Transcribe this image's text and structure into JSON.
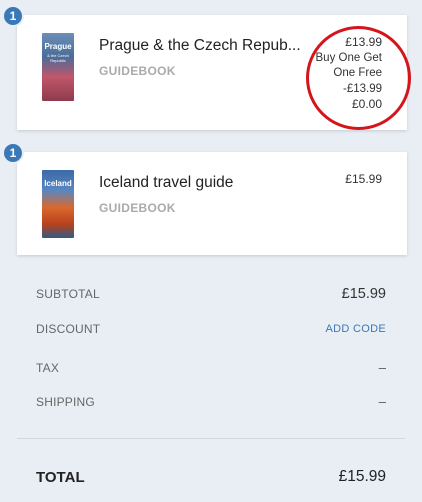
{
  "items": [
    {
      "quantity": "1",
      "cover_title": "Prague",
      "cover_subtitle": "& the Czech Republic",
      "title": "Prague & the Czech Repub...",
      "type": "GUIDEBOOK",
      "price": "£13.99",
      "promo_line1": "Buy One Get",
      "promo_line2": "One Free",
      "discount": "-£13.99",
      "final_price": "£0.00"
    },
    {
      "quantity": "1",
      "cover_title": "Iceland",
      "title": "Iceland travel guide",
      "type": "GUIDEBOOK",
      "price": "£15.99"
    }
  ],
  "summary": {
    "subtotal_label": "SUBTOTAL",
    "subtotal_value": "£15.99",
    "discount_label": "DISCOUNT",
    "add_code_label": "ADD CODE",
    "tax_label": "TAX",
    "tax_value": "–",
    "shipping_label": "SHIPPING",
    "shipping_value": "–",
    "total_label": "TOTAL",
    "total_value": "£15.99"
  },
  "colors": {
    "accent": "#3a78b7",
    "annotation": "#d4161c",
    "background": "#e8eef4"
  }
}
